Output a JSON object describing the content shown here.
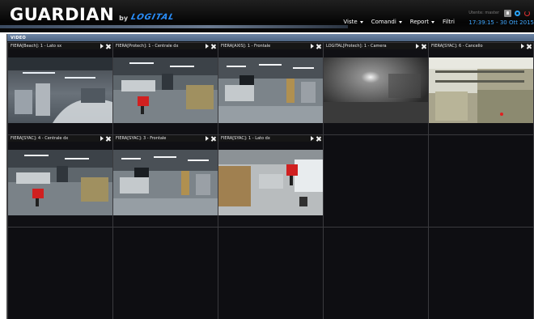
{
  "header": {
    "brand_name": "GUARDIAN",
    "brand_by": "by",
    "brand_logo": "LOGITAL",
    "user_label": "Utente: master",
    "datetime": "17:39:15 - 30 Ott 2015",
    "nav": [
      {
        "label": "Viste",
        "has_dropdown": true
      },
      {
        "label": "Comandi",
        "has_dropdown": true
      },
      {
        "label": "Report",
        "has_dropdown": true
      },
      {
        "label": "Filtri",
        "has_dropdown": false
      }
    ],
    "icons": [
      "user-icon",
      "settings-icon",
      "power-icon"
    ]
  },
  "panel": {
    "title": "VIDEO"
  },
  "colors": {
    "accent_blue": "#2a90ff",
    "datetime_blue": "#40a8ff",
    "panel_title_bg": "#5a7292",
    "power_red": "#e03030"
  },
  "cameras": [
    {
      "title": "FIERA[Beach]: 1 - Lato sx",
      "scene": "lab-ceiling"
    },
    {
      "title": "FIERA[Protech]: 1 - Centrale dx",
      "scene": "lab-chair"
    },
    {
      "title": "FIERA[AXIS]: 1 - Frontale",
      "scene": "lab-wide"
    },
    {
      "title": "LOGITAL[Protech]: 1 - Camera",
      "scene": "dark-room"
    },
    {
      "title": "FIERA[SYAC]: 6 - Cancello",
      "scene": "gate"
    },
    {
      "title": "FIERA[SYAC]: 4 - Centrale dx",
      "scene": "lab-chair"
    },
    {
      "title": "FIERA[SYAC]: 3 - Frontale",
      "scene": "lab-wide"
    },
    {
      "title": "FIERA[SYAC]: 1 - Lato dx",
      "scene": "lab-tables"
    }
  ]
}
